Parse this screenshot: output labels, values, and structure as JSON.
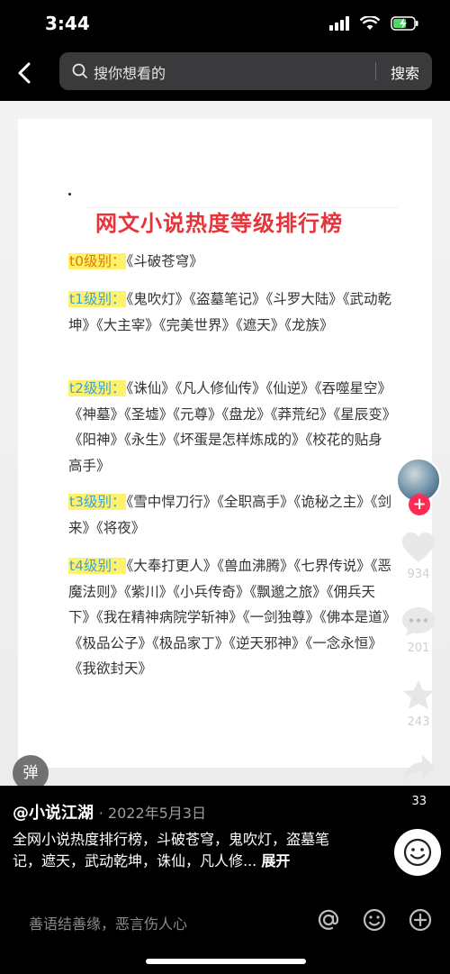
{
  "status_bar": {
    "time": "3:44"
  },
  "search": {
    "placeholder": "搜你想看的",
    "button_label": "搜索"
  },
  "document": {
    "title": "网文小说热度等级排行榜",
    "tiers": [
      {
        "label": "t0级别：",
        "books": "《斗破苍穹》"
      },
      {
        "label": "t1级别：",
        "books": "《鬼吹灯》《盗墓笔记》《斗罗大陆》《武动乾坤》《大主宰》《完美世界》《遮天》《龙族》"
      },
      {
        "label": "t2级别：",
        "books": "《诛仙》《凡人修仙传》《仙逆》《吞噬星空》《神墓》《圣墟》《元尊》《盘龙》《莽荒纪》《星辰变》《阳神》《永生》《坏蛋是怎样炼成的》《校花的贴身高手》"
      },
      {
        "label": "t3级别：",
        "books": "《雪中悍刀行》《全职高手》《诡秘之主》《剑来》《将夜》"
      },
      {
        "label": "t4级别：",
        "books": "《大奉打更人》《兽血沸腾》《七界传说》《恶魔法则》《紫川》《小兵传奇》《飘邈之旅》《佣兵天下》《我在精神病院学斩神》《一剑独尊》《佛本是道》《极品公子》《极品家丁》《逆天邪神》《一念永恒》《我欲封天》"
      }
    ]
  },
  "actions": {
    "like_count": "934",
    "comment_count": "201",
    "favorite_count": "243",
    "share_count": "33",
    "danmu_label": "弹"
  },
  "post": {
    "author": "@小说江湖",
    "date": "· 2022年5月3日",
    "description": "全网小说热度排行榜，斗破苍穹，鬼吹灯，盗墓笔记，遮天，武动乾坤，诛仙，凡人修...",
    "expand_label": "展开"
  },
  "comment_bar": {
    "placeholder": "善语结善缘，恶言伤人心"
  }
}
